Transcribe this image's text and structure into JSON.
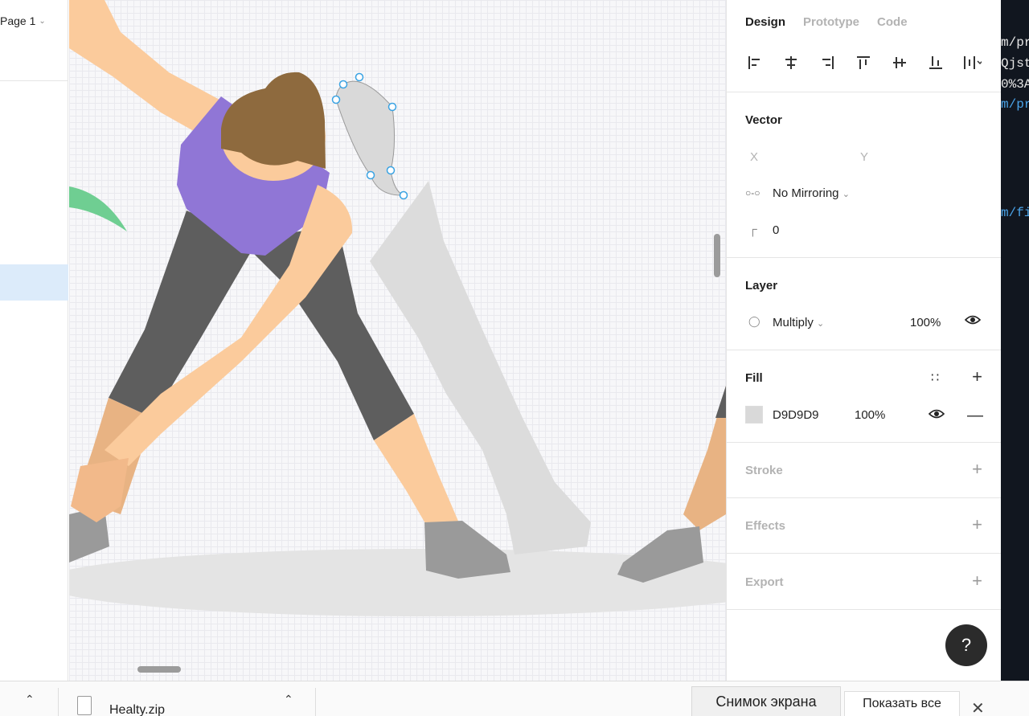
{
  "layers_panel": {
    "page_label": "Page 1"
  },
  "tabs": [
    {
      "label": "Design",
      "active": true
    },
    {
      "label": "Prototype",
      "active": false
    },
    {
      "label": "Code",
      "active": false
    }
  ],
  "align_icons": [
    "align-left-icon",
    "align-horizontal-center-icon",
    "align-right-icon",
    "align-top-icon",
    "align-vertical-center-icon",
    "align-bottom-icon",
    "distribute-icon"
  ],
  "vector": {
    "title": "Vector",
    "x_label": "X",
    "y_label": "Y",
    "mirroring": "No Mirroring",
    "corner_radius": "0"
  },
  "layer": {
    "title": "Layer",
    "blend_mode": "Multiply",
    "opacity": "100%"
  },
  "fill": {
    "title": "Fill",
    "color_hex": "D9D9D9",
    "opacity": "100%",
    "swatch_color": "#d9d9d9"
  },
  "stroke": {
    "title": "Stroke"
  },
  "effects": {
    "title": "Effects"
  },
  "export": {
    "title": "Export"
  },
  "help": {
    "label": "?"
  },
  "code_strip": {
    "lines": [
      "m/pr",
      "Qjsty",
      "0%3A",
      "m/pr",
      "m/fil"
    ]
  },
  "download_bar": {
    "file_name": "Healty.zip",
    "snapshot_label": "Снимок экрана",
    "show_all_label": "Показать все"
  },
  "colors": {
    "skin": "#fbcb9c",
    "shirt": "#9076d6",
    "hair": "#8e6a3e",
    "pants": "#5e5e5e",
    "shoes": "#9a9a9a",
    "shadow": "#dedede",
    "selection": "#3aa3e3"
  }
}
